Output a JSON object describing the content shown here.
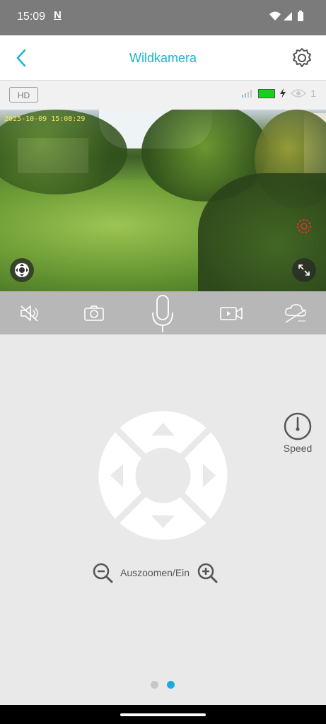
{
  "status": {
    "time": "15:09",
    "nfc": "N"
  },
  "appbar": {
    "title": "Wildkamera"
  },
  "info": {
    "quality": "HD",
    "viewers": "1"
  },
  "video": {
    "timestamp": "2025-10-09 15:08:29"
  },
  "controls": [
    "speaker-muted",
    "snapshot",
    "microphone",
    "record-video",
    "cloud"
  ],
  "ptz": {
    "speed_label": "Speed",
    "zoom_label": "Auszoomen/Ein"
  },
  "pager": {
    "pages": 2,
    "active": 2
  },
  "colors": {
    "accent": "#1bb4cf",
    "dot_active": "#1ba9e3",
    "battery": "#19d019",
    "record": "#e0312b"
  }
}
